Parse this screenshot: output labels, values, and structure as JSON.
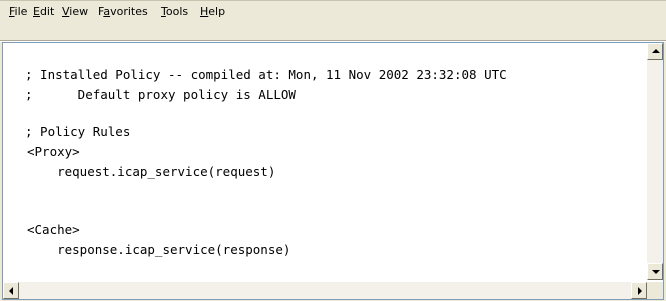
{
  "menu": {
    "items": [
      {
        "prefix": "",
        "underline": "F",
        "rest": "ile"
      },
      {
        "prefix": "",
        "underline": "E",
        "rest": "dit"
      },
      {
        "prefix": "",
        "underline": "V",
        "rest": "iew"
      },
      {
        "prefix": "F",
        "underline": "a",
        "rest": "vorites"
      },
      {
        "prefix": "",
        "underline": "T",
        "rest": "ools"
      },
      {
        "prefix": "",
        "underline": "H",
        "rest": "elp"
      }
    ]
  },
  "document": {
    "lines": [
      "; Installed Policy -- compiled at: Mon, 11 Nov 2002 23:32:08 UTC",
      ";      Default proxy policy is ALLOW",
      "; Policy Rules",
      "<Proxy>",
      "    request.icap_service(request)",
      "<Cache>",
      "    response.icap_service(response)"
    ]
  },
  "icons": {
    "scroll_up": "scroll-up-arrow-icon",
    "scroll_down": "scroll-down-arrow-icon",
    "scroll_left": "scroll-left-arrow-icon",
    "scroll_right": "scroll-right-arrow-icon"
  },
  "colors": {
    "chrome": "#ece9d8",
    "frame_border": "#7f9db9",
    "text": "#000000"
  }
}
